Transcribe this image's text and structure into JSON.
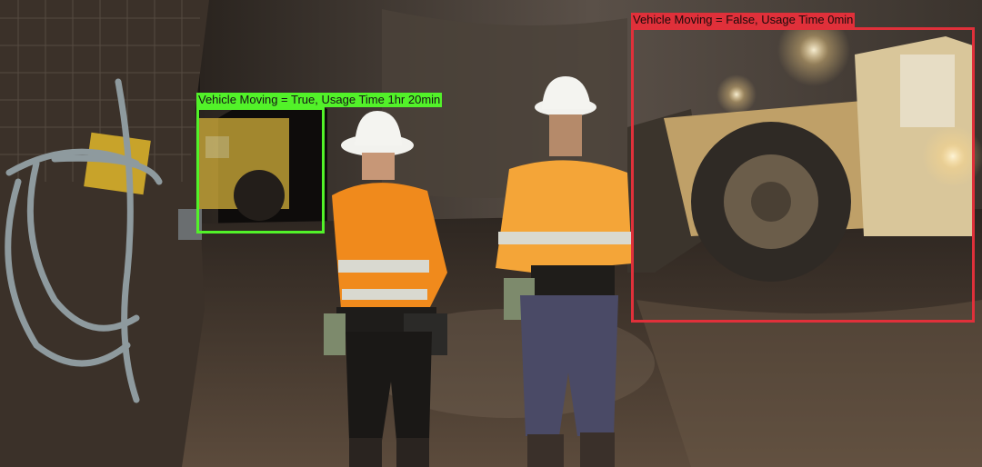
{
  "detections": [
    {
      "label": "Vehicle Moving = True, Usage Time 1hr 20min",
      "color": "#52f229",
      "moving": true
    },
    {
      "label": "Vehicle Moving = False, Usage Time 0min",
      "color": "#e0303a",
      "moving": false
    }
  ],
  "colors": {
    "rock": "#3a3128",
    "floor": "#5a4a3c",
    "hivis_orange": "#f08a1c",
    "reflective_stripe": "#d9d9d0",
    "loader_yellow": "#c9a45a"
  }
}
